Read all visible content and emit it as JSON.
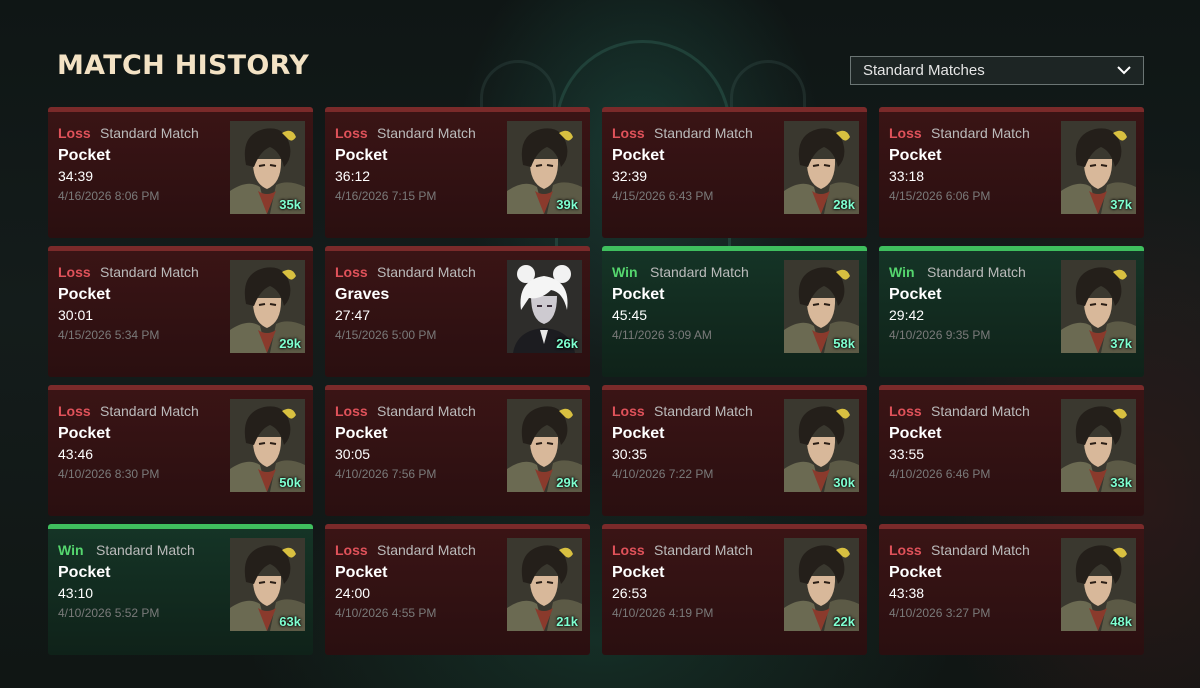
{
  "header": {
    "title": "MATCH HISTORY"
  },
  "filter": {
    "selected": "Standard Matches"
  },
  "matches": [
    {
      "result": "Loss",
      "mode": "Standard Match",
      "champion": "Pocket",
      "duration": "34:39",
      "date": "4/16/2026 8:06 PM",
      "score": "35k",
      "hero": "pocket"
    },
    {
      "result": "Loss",
      "mode": "Standard Match",
      "champion": "Pocket",
      "duration": "36:12",
      "date": "4/16/2026 7:15 PM",
      "score": "39k",
      "hero": "pocket"
    },
    {
      "result": "Loss",
      "mode": "Standard Match",
      "champion": "Pocket",
      "duration": "32:39",
      "date": "4/15/2026 6:43 PM",
      "score": "28k",
      "hero": "pocket"
    },
    {
      "result": "Loss",
      "mode": "Standard Match",
      "champion": "Pocket",
      "duration": "33:18",
      "date": "4/15/2026 6:06 PM",
      "score": "37k",
      "hero": "pocket"
    },
    {
      "result": "Loss",
      "mode": "Standard Match",
      "champion": "Pocket",
      "duration": "30:01",
      "date": "4/15/2026 5:34 PM",
      "score": "29k",
      "hero": "pocket"
    },
    {
      "result": "Loss",
      "mode": "Standard Match",
      "champion": "Graves",
      "duration": "27:47",
      "date": "4/15/2026 5:00 PM",
      "score": "26k",
      "hero": "graves"
    },
    {
      "result": "Win",
      "mode": "Standard Match",
      "champion": "Pocket",
      "duration": "45:45",
      "date": "4/11/2026 3:09 AM",
      "score": "58k",
      "hero": "pocket"
    },
    {
      "result": "Win",
      "mode": "Standard Match",
      "champion": "Pocket",
      "duration": "29:42",
      "date": "4/10/2026 9:35 PM",
      "score": "37k",
      "hero": "pocket"
    },
    {
      "result": "Loss",
      "mode": "Standard Match",
      "champion": "Pocket",
      "duration": "43:46",
      "date": "4/10/2026 8:30 PM",
      "score": "50k",
      "hero": "pocket"
    },
    {
      "result": "Loss",
      "mode": "Standard Match",
      "champion": "Pocket",
      "duration": "30:05",
      "date": "4/10/2026 7:56 PM",
      "score": "29k",
      "hero": "pocket"
    },
    {
      "result": "Loss",
      "mode": "Standard Match",
      "champion": "Pocket",
      "duration": "30:35",
      "date": "4/10/2026 7:22 PM",
      "score": "30k",
      "hero": "pocket"
    },
    {
      "result": "Loss",
      "mode": "Standard Match",
      "champion": "Pocket",
      "duration": "33:55",
      "date": "4/10/2026 6:46 PM",
      "score": "33k",
      "hero": "pocket"
    },
    {
      "result": "Win",
      "mode": "Standard Match",
      "champion": "Pocket",
      "duration": "43:10",
      "date": "4/10/2026 5:52 PM",
      "score": "63k",
      "hero": "pocket"
    },
    {
      "result": "Loss",
      "mode": "Standard Match",
      "champion": "Pocket",
      "duration": "24:00",
      "date": "4/10/2026 4:55 PM",
      "score": "21k",
      "hero": "pocket"
    },
    {
      "result": "Loss",
      "mode": "Standard Match",
      "champion": "Pocket",
      "duration": "26:53",
      "date": "4/10/2026 4:19 PM",
      "score": "22k",
      "hero": "pocket"
    },
    {
      "result": "Loss",
      "mode": "Standard Match",
      "champion": "Pocket",
      "duration": "43:38",
      "date": "4/10/2026 3:27 PM",
      "score": "48k",
      "hero": "pocket"
    }
  ],
  "colors": {
    "loss": "#e0525a",
    "win": "#55d66e",
    "score": "#7fffd0",
    "title": "#f3e2c4"
  }
}
